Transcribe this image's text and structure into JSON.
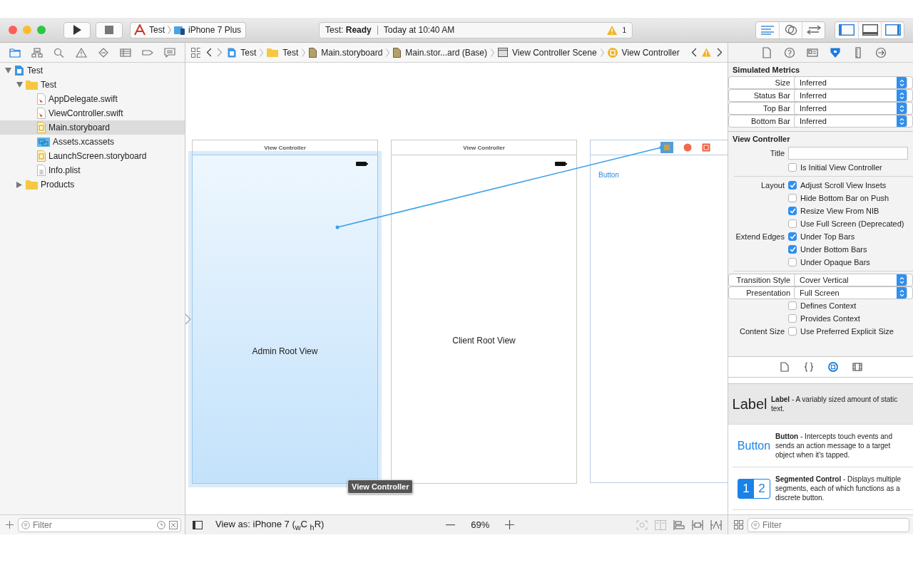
{
  "toolbar": {
    "scheme": "Test",
    "device": "iPhone 7 Plus",
    "status": "Test: **Ready**",
    "time": "Today at 10:40 AM",
    "warning_count": "1",
    "editor_modes": [
      {
        "kind": "standard",
        "selected": true
      },
      {
        "kind": "assistant",
        "selected": false
      },
      {
        "kind": "version",
        "selected": false
      }
    ],
    "panels": [
      {
        "kind": "left",
        "on": true
      },
      {
        "kind": "bottom",
        "on": false
      },
      {
        "kind": "right",
        "on": true
      }
    ]
  },
  "navigator_tabs": [
    {
      "kind": "folder",
      "selected": true
    },
    {
      "kind": "hierarchy",
      "selected": false
    },
    {
      "kind": "search",
      "selected": false
    },
    {
      "kind": "warning",
      "selected": false
    },
    {
      "kind": "test",
      "selected": false
    },
    {
      "kind": "debug",
      "selected": false
    },
    {
      "kind": "breakpoint",
      "selected": false
    },
    {
      "kind": "report",
      "selected": false
    }
  ],
  "navigator": [
    {
      "kind": "project",
      "label": "Test",
      "selected": false,
      "expanded": true,
      "children": [
        {
          "kind": "folder",
          "label": "Test",
          "selected": false,
          "expanded": true,
          "children": [
            {
              "kind": "swift",
              "label": "AppDelegate.swift",
              "selected": false
            },
            {
              "kind": "swift",
              "label": "ViewController.swift",
              "selected": false
            },
            {
              "kind": "storyboard",
              "label": "Main.storyboard",
              "selected": true
            },
            {
              "kind": "assets",
              "label": "Assets.xcassets",
              "selected": false
            },
            {
              "kind": "storyboard",
              "label": "LaunchScreen.storyboard",
              "selected": false
            },
            {
              "kind": "plist",
              "label": "Info.plist",
              "selected": false
            }
          ]
        },
        {
          "kind": "folder",
          "label": "Products",
          "selected": false,
          "expanded": false
        }
      ]
    }
  ],
  "navigator_filter": {
    "placeholder": "Filter"
  },
  "jump_bar": [
    {
      "kind": "project",
      "label": "Test"
    },
    {
      "kind": "folder",
      "label": "Test"
    },
    {
      "kind": "storyboard",
      "label": "Main.storyboard"
    },
    {
      "kind": "storyboard",
      "label": "Main.stor...ard (Base)"
    },
    {
      "kind": "scene",
      "label": "View Controller Scene"
    },
    {
      "kind": "controller",
      "label": "View Controller"
    }
  ],
  "canvas": {
    "scenes": [
      {
        "kind": "view",
        "title": "View Controller",
        "label": "Admin Root View",
        "selected": true
      },
      {
        "kind": "view",
        "title": "View Controller",
        "label": "Client Root View",
        "selected": false
      },
      {
        "kind": "buttons",
        "button": "Button",
        "selected": false
      }
    ],
    "tooltip": "View Controller"
  },
  "canvas_bar": {
    "view_as": "View as: iPhone 7 ($_{w}$C $_{h}$R)",
    "zoom": "69%"
  },
  "inspector_tabs": [
    {
      "kind": "file",
      "selected": false
    },
    {
      "kind": "help",
      "selected": false
    },
    {
      "kind": "identity",
      "selected": false
    },
    {
      "kind": "attributes",
      "selected": true
    },
    {
      "kind": "size",
      "selected": false
    },
    {
      "kind": "connections",
      "selected": false
    }
  ],
  "inspector": [
    {
      "title": "Simulated Metrics",
      "groups": [
        [
          {
            "kind": "popup",
            "label": "Size",
            "value": "Inferred"
          },
          {
            "kind": "popup",
            "label": "Status Bar",
            "value": "Inferred"
          },
          {
            "kind": "popup",
            "label": "Top Bar",
            "value": "Inferred"
          },
          {
            "kind": "popup",
            "label": "Bottom Bar",
            "value": "Inferred"
          }
        ]
      ]
    },
    {
      "title": "View Controller",
      "groups": [
        [
          {
            "kind": "field",
            "label": "Title"
          },
          {
            "kind": "checkbox",
            "text": "Is Initial View Controller",
            "checked": false
          }
        ],
        [
          {
            "kind": "checkbox",
            "label": "Layout",
            "text": "Adjust Scroll View Insets",
            "checked": true
          },
          {
            "kind": "checkbox",
            "text": "Hide Bottom Bar on Push",
            "checked": false
          },
          {
            "kind": "checkbox",
            "text": "Resize View From NIB",
            "checked": true
          },
          {
            "kind": "checkbox",
            "text": "Use Full Screen (Deprecated)",
            "checked": false
          },
          {
            "kind": "checkbox",
            "label": "Extend Edges",
            "text": "Under Top Bars",
            "checked": true
          },
          {
            "kind": "checkbox",
            "text": "Under Bottom Bars",
            "checked": true
          },
          {
            "kind": "checkbox",
            "text": "Under Opaque Bars",
            "checked": false
          }
        ],
        [
          {
            "kind": "popup",
            "label": "Transition Style",
            "value": "Cover Vertical"
          },
          {
            "kind": "popup",
            "label": "Presentation",
            "value": "Full Screen"
          },
          {
            "kind": "checkbox",
            "text": "Defines Context",
            "checked": false
          },
          {
            "kind": "checkbox",
            "text": "Provides Context",
            "checked": false
          },
          {
            "kind": "checkbox",
            "label": "Content Size",
            "text": "Use Preferred Explicit Size",
            "checked": false
          }
        ]
      ]
    }
  ],
  "library_tabs": [
    {
      "kind": "file",
      "selected": false
    },
    {
      "kind": "code",
      "selected": false
    },
    {
      "kind": "object",
      "selected": true
    },
    {
      "kind": "media",
      "selected": false
    }
  ],
  "library": [
    {
      "kind": "label",
      "preview": "Label",
      "text": "**Label** - A variably sized amount of static text.",
      "selected": true
    },
    {
      "kind": "button",
      "preview": "Button",
      "text": "**Button** - Intercepts touch events and sends an action message to a target object when it's tapped.",
      "selected": false
    },
    {
      "kind": "segmented",
      "segments": [
        "1",
        "2"
      ],
      "text": "**Segmented Control** - Displays multiple segments, each of which functions as a discrete button.",
      "selected": false
    }
  ],
  "library_filter": {
    "placeholder": "Filter"
  }
}
